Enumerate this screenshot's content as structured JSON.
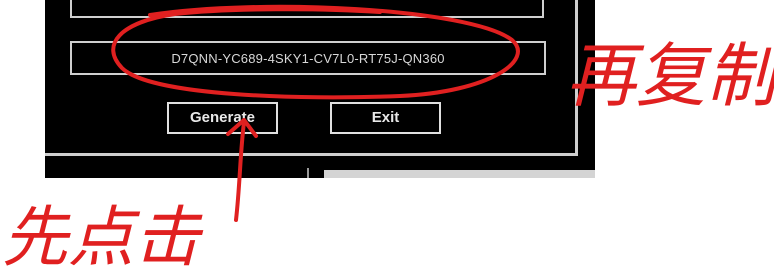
{
  "keygen": {
    "serial": "D7QNN-YC689-4SKY1-CV7L0-RT75J-QN360",
    "generate_label": "Generate",
    "exit_label": "Exit"
  },
  "annotations": {
    "copy_note": "再复制",
    "click_first_note": "先点击",
    "color": "#e02020"
  }
}
